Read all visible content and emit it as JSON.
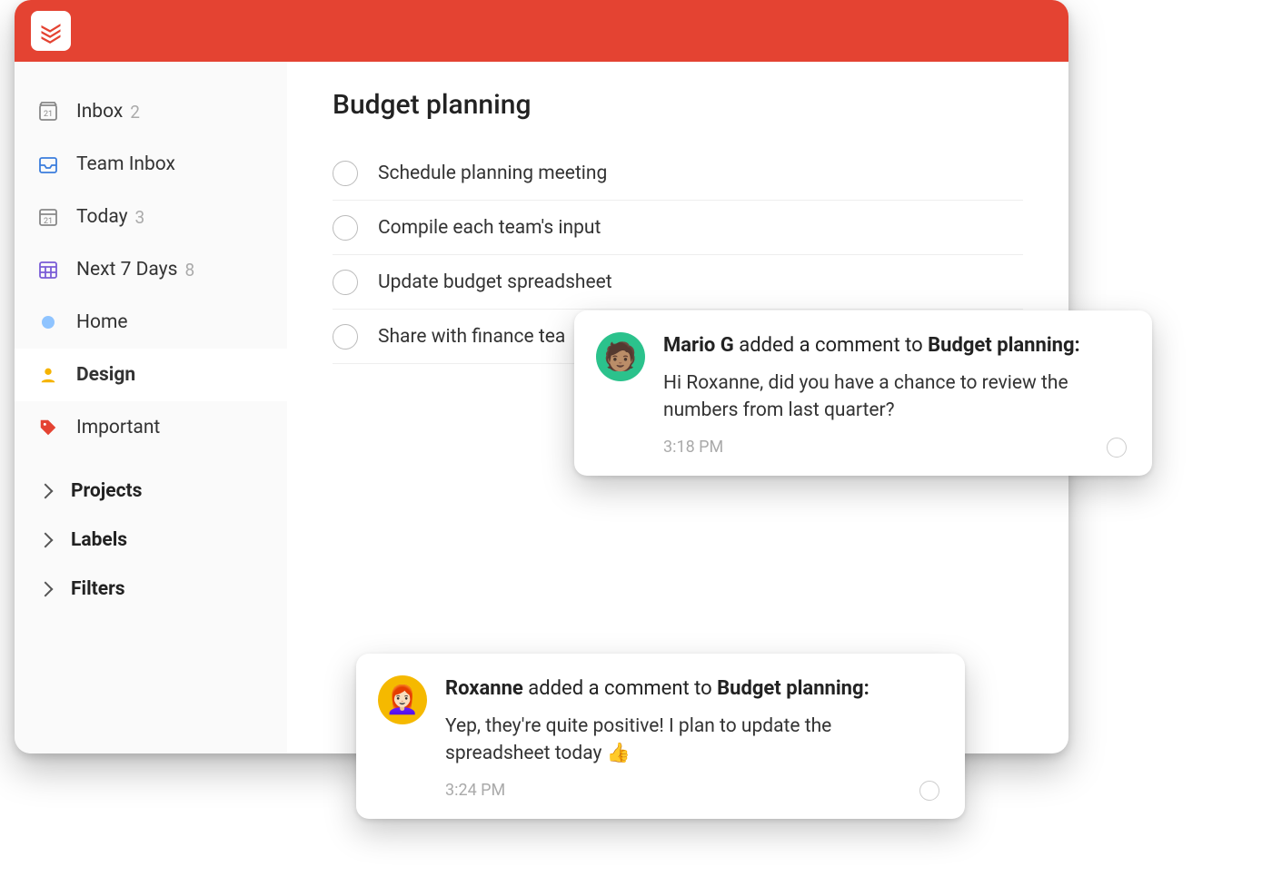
{
  "sidebar": {
    "items": [
      {
        "label": "Inbox",
        "count": "2"
      },
      {
        "label": "Team Inbox",
        "count": ""
      },
      {
        "label": "Today",
        "count": "3"
      },
      {
        "label": "Next 7 Days",
        "count": "8"
      },
      {
        "label": "Home",
        "count": ""
      },
      {
        "label": "Design",
        "count": ""
      },
      {
        "label": "Important",
        "count": ""
      }
    ],
    "sections": [
      {
        "label": "Projects"
      },
      {
        "label": "Labels"
      },
      {
        "label": "Filters"
      }
    ]
  },
  "main": {
    "title": "Budget planning",
    "tasks": [
      "Schedule planning meeting",
      "Compile each team's input",
      "Update budget spreadsheet",
      "Share with finance tea"
    ]
  },
  "notifications": [
    {
      "author": "Mario G",
      "action": " added a comment to ",
      "target": "Budget planning:",
      "message": "Hi Roxanne, did you have a chance to review the numbers from last quarter?",
      "time": "3:18 PM"
    },
    {
      "author": "Roxanne",
      "action": " added a comment to ",
      "target": "Budget planning:",
      "message": "Yep, they're quite positive! I plan to update the spreadsheet today 👍",
      "time": "3:24 PM"
    }
  ]
}
